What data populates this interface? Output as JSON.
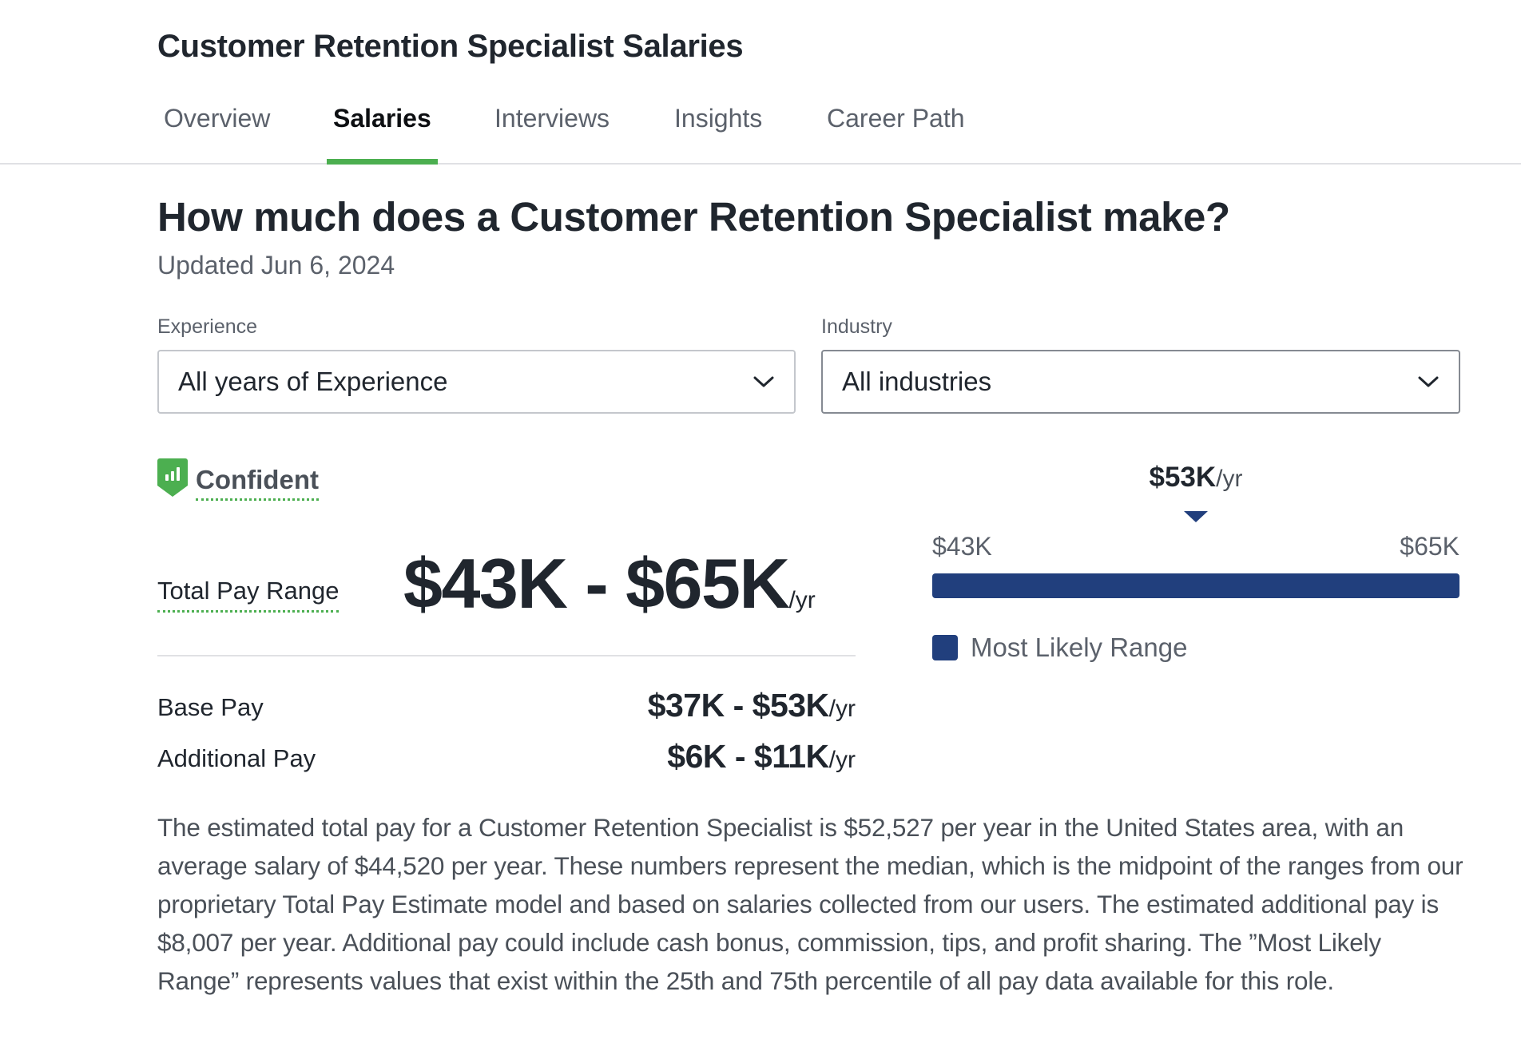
{
  "header": {
    "title": "Customer Retention Specialist Salaries"
  },
  "tabs": [
    {
      "label": "Overview",
      "active": false
    },
    {
      "label": "Salaries",
      "active": true
    },
    {
      "label": "Interviews",
      "active": false
    },
    {
      "label": "Insights",
      "active": false
    },
    {
      "label": "Career Path",
      "active": false
    }
  ],
  "main": {
    "heading": "How much does a Customer Retention Specialist make?",
    "updated": "Updated Jun 6, 2024"
  },
  "filters": {
    "experience": {
      "label": "Experience",
      "value": "All years of Experience"
    },
    "industry": {
      "label": "Industry",
      "value": "All industries"
    }
  },
  "confidence": {
    "label": "Confident",
    "icon": "bar-chart-shield-icon"
  },
  "pay": {
    "total_label": "Total Pay Range",
    "total_range": "$43K - $65K",
    "per": "/yr",
    "base_label": "Base Pay",
    "base_range": "$37K - $53K",
    "additional_label": "Additional Pay",
    "additional_range": "$6K - $11K"
  },
  "description": "The estimated total pay for a Customer Retention Specialist is $52,527 per year in the United States area, with an average salary of $44,520 per year. These numbers represent the median, which is the midpoint of the ranges from our proprietary Total Pay Estimate model and based on salaries collected from our users. The estimated additional pay is $8,007 per year. Additional pay could include cash bonus, commission, tips, and profit sharing. The ”Most Likely Range” represents values that exist within the 25th and 75th percentile of all pay data available for this role.",
  "chart_data": {
    "type": "bar",
    "orientation": "horizontal-range",
    "median_label": "$53K",
    "median_unit": "/yr",
    "median_value": 53,
    "min_label": "$43K",
    "max_label": "$65K",
    "range": [
      43,
      65
    ],
    "axis_range": [
      43,
      65
    ],
    "units": "thousand USD per year",
    "legend": [
      {
        "label": "Most Likely Range",
        "color": "#213f7d"
      }
    ],
    "series": [
      {
        "name": "Most Likely Range",
        "low": 43,
        "high": 65
      }
    ]
  },
  "colors": {
    "accent_green": "#4caf50",
    "range_blue": "#213f7d",
    "text_dark": "#20262e",
    "text_muted": "#5b616b"
  }
}
